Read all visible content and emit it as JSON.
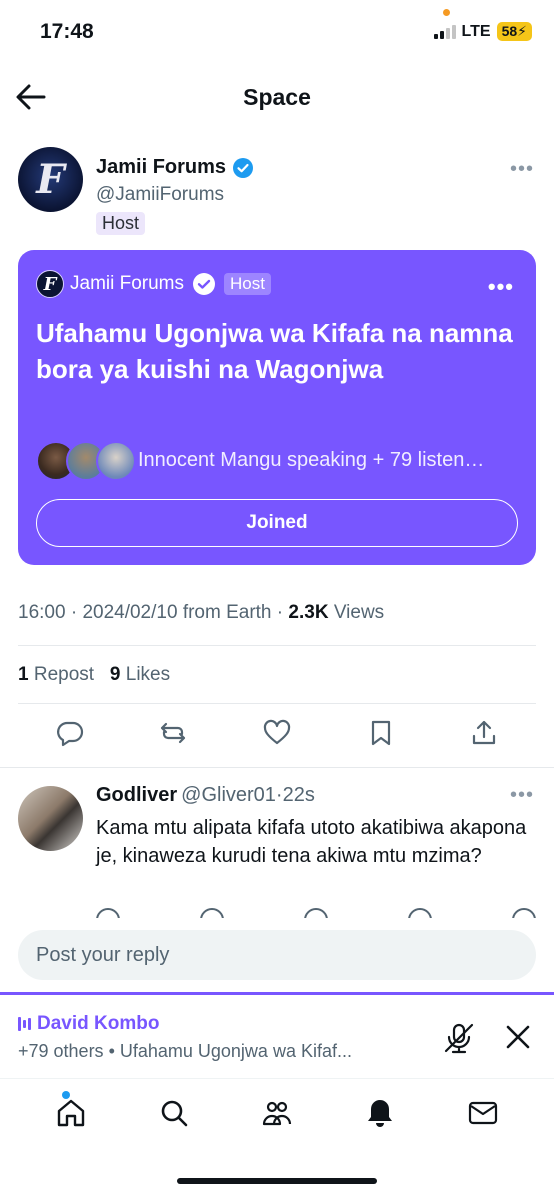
{
  "status_bar": {
    "time": "17:48",
    "network": "LTE",
    "battery": "58"
  },
  "header": {
    "title": "Space"
  },
  "author": {
    "avatar_letter": "F",
    "name": "Jamii Forums",
    "handle": "@JamiiForums",
    "badge": "Host"
  },
  "space_card": {
    "host_avatar_letter": "F",
    "host_name": "Jamii Forums",
    "host_badge": "Host",
    "title": "Ufahamu Ugonjwa wa Kifafa na namna bora ya kuishi na Wagonjwa",
    "speaking": "Innocent Mangu speaking + 79 listen…",
    "joined_label": "Joined",
    "color": "#7856ff"
  },
  "meta": {
    "time": "16:00",
    "date": "2024/02/10",
    "source": "from Earth",
    "views_count": "2.3K",
    "views_label": "Views"
  },
  "stats": {
    "reposts_count": "1",
    "reposts_label": "Repost",
    "likes_count": "9",
    "likes_label": "Likes"
  },
  "reply": {
    "name": "Godliver",
    "handle": "@Gliver01",
    "time": "22s",
    "text": "Kama mtu alipata kifafa utoto akatibiwa akapona je, kinaweza kurudi tena akiwa mtu mzima?"
  },
  "reply_input": {
    "placeholder": "Post your reply"
  },
  "live_dock": {
    "speaker": "David Kombo",
    "subtitle": "+79 others • Ufahamu Ugonjwa wa Kifaf..."
  },
  "bottom_nav": [
    "home-icon",
    "search-icon",
    "communities-icon",
    "notifications-icon",
    "messages-icon"
  ]
}
